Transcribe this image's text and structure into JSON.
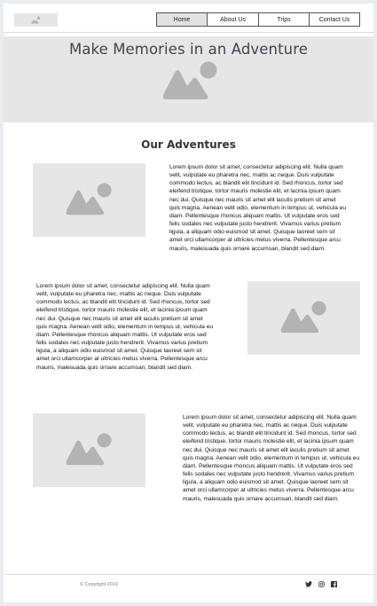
{
  "header": {
    "nav": [
      "Home",
      "About Us",
      "Trips",
      "Contact Us"
    ],
    "active_nav": "Home"
  },
  "hero": {
    "title": "Make Memories in an Adventure"
  },
  "section": {
    "title": "Our Adventures",
    "paragraph": "Lorem ipsum dolor sit amet, consectetur adipiscing elit. Nulla quam velit, vulputate eu pharetra nec, mattis ac neque. Duis vulputate commodo lectus, ac blandit elit tincidunt id. Sed rhoncus, tortor sed eleifend tristique, tortor mauris molestie elit, et lacinia ipsum quam nec dui. Quisque nec mauris sit amet elit iaculis pretium sit amet quis magna. Aenean velit odio, elementum in tempus ut, vehicula eu diam. Pellentesque rhoncus aliquam mattis. Ut vulputate eros sed felis sodales nec vulputate justo hendrerit. Vivamus varius pretium ligula, a aliquam odio euismod sit amet. Quisque laoreet sem sit amet orci ullamcorper at ultricies metus viverra. Pellentesque arcu mauris, malesuada quis ornare accumsan, blandit sed diam."
  },
  "footer": {
    "copyright": "© Copyright 2019",
    "social_icons": [
      "twitter-icon",
      "instagram-icon",
      "facebook-icon"
    ]
  },
  "colors": {
    "placeholder_bg": "#e6e6e6",
    "placeholder_icon": "#b3b3b3",
    "heading": "#3d4650"
  }
}
